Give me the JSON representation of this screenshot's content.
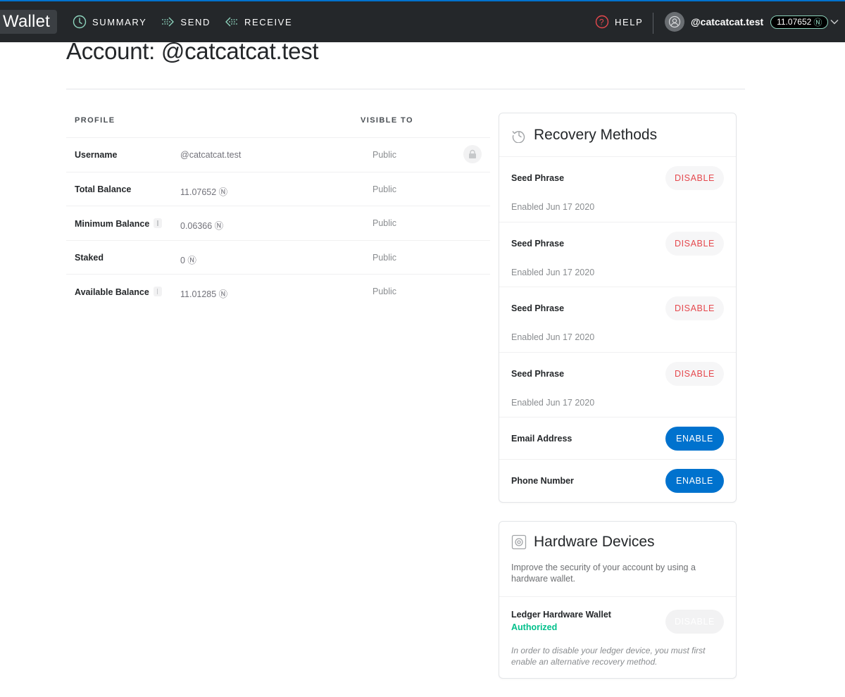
{
  "nav": {
    "logo": "Wallet",
    "summary": "SUMMARY",
    "send": "SEND",
    "receive": "RECEIVE",
    "help": "HELP",
    "account_name": "@catcatcat.test",
    "account_balance": "11.07652",
    "near_symbol": "Ⓝ",
    "accent_color": "#0072ce",
    "balance_border_color": "#8dd4bd"
  },
  "page": {
    "title": "Account: @catcatcat.test"
  },
  "profile": {
    "col_profile": "PROFILE",
    "col_visible": "VISIBLE TO",
    "rows": [
      {
        "label": "Username",
        "value": "@catcatcat.test",
        "visible": "Public",
        "icon": "lock-icon"
      },
      {
        "label": "Total Balance",
        "value": "11.07652 Ⓝ",
        "visible": "Public"
      },
      {
        "label": "Minimum Balance",
        "value": "0.06366 Ⓝ",
        "visible": "Public",
        "info": true
      },
      {
        "label": "Staked",
        "value": "0 Ⓝ",
        "visible": "Public"
      },
      {
        "label": "Available Balance",
        "value": "11.01285 Ⓝ",
        "visible": "Public",
        "info": true
      }
    ]
  },
  "recovery": {
    "title": "Recovery Methods",
    "icon": "history-icon",
    "methods": [
      {
        "name": "Seed Phrase",
        "date": "Enabled Jun 17 2020",
        "action": "DISABLE"
      },
      {
        "name": "Seed Phrase",
        "date": "Enabled Jun 17 2020",
        "action": "DISABLE"
      },
      {
        "name": "Seed Phrase",
        "date": "Enabled Jun 17 2020",
        "action": "DISABLE"
      },
      {
        "name": "Seed Phrase",
        "date": "Enabled Jun 17 2020",
        "action": "DISABLE"
      }
    ],
    "email": {
      "name": "Email Address",
      "action": "ENABLE"
    },
    "phone": {
      "name": "Phone Number",
      "action": "ENABLE"
    },
    "disable_color": "#e5484d",
    "enable_color": "#0072ce"
  },
  "hardware": {
    "title": "Hardware Devices",
    "icon": "hardware-device-icon",
    "description": "Improve the security of your account by using a hardware wallet.",
    "device_name": "Ledger Hardware Wallet",
    "status": "Authorized",
    "status_color": "#00c08b",
    "action": "DISABLE",
    "note": "In order to disable your ledger device, you must first enable an alternative recovery method."
  }
}
